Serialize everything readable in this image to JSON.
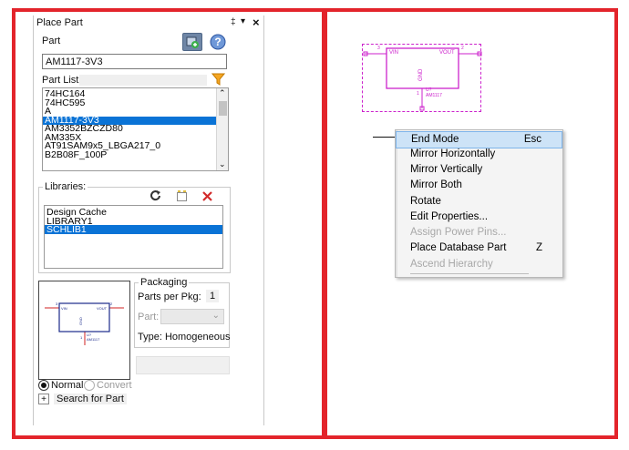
{
  "panel": {
    "title": "Place Part",
    "pin_glyph": "‡",
    "dropdown_glyph": "▾",
    "close_glyph": "×",
    "part_label": "Part",
    "part_value": "AM1117-3V3",
    "part_list_label": "Part List:",
    "part_list": [
      "74HC164",
      "74HC595",
      "A",
      "AM1117-3V3",
      "AM3352BZCZD80",
      "AM335X",
      "AT91SAM9x5_LBGA217_0",
      "B2B08F_100P"
    ],
    "part_list_selected": "AM1117-3V3",
    "libraries_label": "Libraries:",
    "libraries": [
      "Design Cache",
      "LIBRARY1",
      "SCHLIB1"
    ],
    "libraries_selected": "SCHLIB1",
    "packaging_label": "Packaging",
    "parts_per_pkg_label": "Parts per Pkg:",
    "parts_per_pkg_value": "1",
    "part_label_small": "Part:",
    "type_label": "Type: Homogeneous",
    "normal_label": "Normal",
    "convert_label": "Convert",
    "search_plus": "+",
    "search_label": "Search for Part"
  },
  "preview": {
    "vin": "VIN",
    "vout": "VOUT",
    "gnd": "GND",
    "pin3": "3",
    "pin2": "2",
    "pin1": "1",
    "ref": "U?",
    "value": "AM1117"
  },
  "schematic": {
    "vin": "VIN",
    "vout": "VOUT",
    "gnd": "GND",
    "pin3": "3",
    "pin2": "2",
    "pin1": "1",
    "ref": "U?",
    "value": "AM1117"
  },
  "context_menu": {
    "items": [
      {
        "label": "End Mode",
        "shortcut": "Esc",
        "state": "highlighted"
      },
      {
        "label": "Mirror Horizontally",
        "shortcut": "",
        "state": "enabled"
      },
      {
        "label": "Mirror Vertically",
        "shortcut": "",
        "state": "enabled"
      },
      {
        "label": "Mirror Both",
        "shortcut": "",
        "state": "enabled"
      },
      {
        "label": "Rotate",
        "shortcut": "",
        "state": "enabled"
      },
      {
        "label": "Edit Properties...",
        "shortcut": "",
        "state": "enabled"
      },
      {
        "label": "Assign Power Pins...",
        "shortcut": "",
        "state": "disabled"
      },
      {
        "label": "Place Database Part",
        "shortcut": "Z",
        "state": "enabled"
      },
      {
        "label": "Ascend Hierarchy",
        "shortcut": "",
        "state": "disabled"
      }
    ]
  },
  "colors": {
    "annotation_red": "#e3242b",
    "part_magenta": "#cc22cc",
    "selection_blue": "#0a73d6",
    "menu_highlight": "#cde3f7",
    "wire_red": "#d22020",
    "preview_blue": "#1a2a8a"
  },
  "icons": [
    "add-part-icon",
    "help-icon",
    "filter-icon",
    "refresh-icon",
    "add-library-icon",
    "remove-library-icon",
    "pin-icon",
    "close-icon"
  ]
}
